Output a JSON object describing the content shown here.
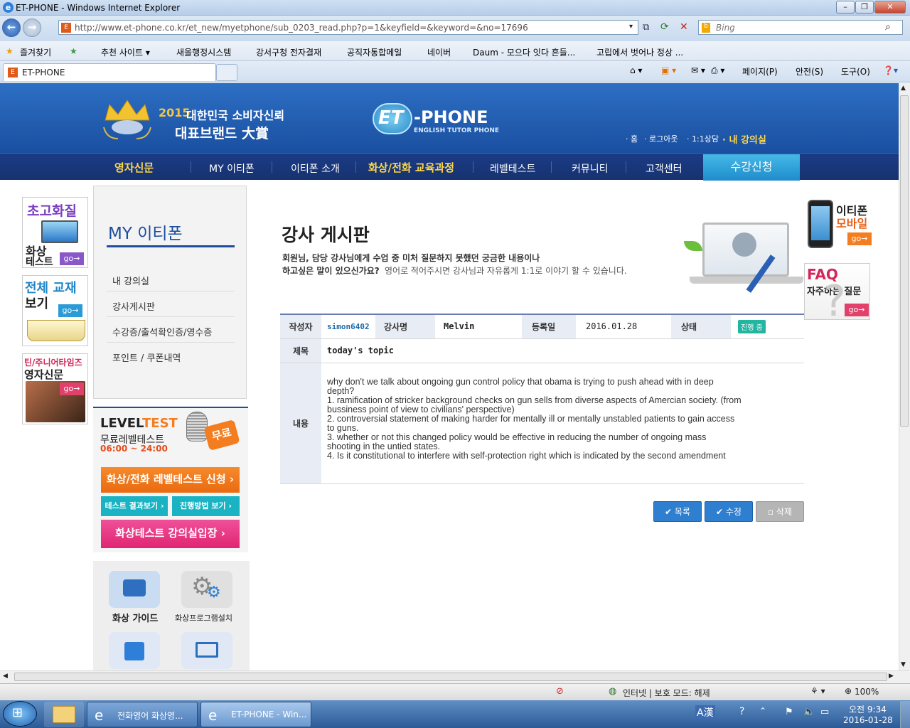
{
  "window": {
    "title": "ET-PHONE - Windows Internet Explorer"
  },
  "address": {
    "url": "http://www.et-phone.co.kr/et_new/myetphone/sub_0203_read.php?p=1&keyfield=&keyword=&no=17696",
    "search_placeholder": "Bing"
  },
  "favorites": {
    "label": "즐겨찾기",
    "items": [
      "추천 사이트 ▾",
      "새올행정시스템",
      "강서구청 전자결재",
      "공직자통합메일",
      "네이버",
      "Daum - 모으다 잇다 흔들...",
      "고립에서 벗어나 정상 ..."
    ]
  },
  "tab": {
    "label": "ET-PHONE"
  },
  "commands": [
    "페이지(P)",
    "안전(S)",
    "도구(O)"
  ],
  "site": {
    "award": {
      "year": "2015",
      "line1": "대한민국 소비자신뢰",
      "line2": "대표브랜드 大賞"
    },
    "logo": {
      "main": "ET",
      "suffix": "-PHONE",
      "sub": "ENGLISH TUTOR PHONE"
    },
    "toplinks": [
      "홈",
      "로그아웃",
      "1:1상담",
      "내 강의실"
    ],
    "menu": [
      "영자신문",
      "MY 이티폰",
      "이티폰 소개",
      "화상/전화 교육과정",
      "레벨테스트",
      "커뮤니티",
      "고객센터"
    ],
    "apply": "수강신청"
  },
  "sidebar": {
    "banners": [
      {
        "title": "초고화질",
        "sub1": "화상",
        "sub2": "테스트",
        "go": "go"
      },
      {
        "title": "전체 교재",
        "sub1": "보기",
        "go": "go"
      },
      {
        "title": "틴/주니어타임즈",
        "sub1": "영자신문",
        "go": "go"
      }
    ],
    "my_title": "MY 이티폰",
    "links": [
      "내 강의실",
      "강사게시판",
      "수강증/출석확인증/영수증",
      "포인트 / 쿠폰내역"
    ],
    "level": {
      "title_a": "LEVEL ",
      "title_b": "TEST",
      "sub": "무료레벨테스트",
      "time": "06:00 ~ 24:00",
      "badge": "무료"
    },
    "btn_apply": "화상/전화 레벨테스트 신청",
    "btn_result": "테스트 결과보기",
    "btn_howto": "진행방법 보기",
    "btn_enter": "화상테스트 강의실입장",
    "icons": [
      "화상 가이드",
      "화상프로그램설치"
    ]
  },
  "board": {
    "title": "강사 게시판",
    "desc1": "회원님, 담당 강사님에게 수업 중 미처 질문하지 못했던 궁금한 내용이나",
    "desc2a": "하고싶은 말이 있으신가요?",
    "desc2b": " 영어로 적어주시면 강사님과 자유롭게 1:1로 이야기 할 수 있습니다.",
    "labels": {
      "writer": "작성자",
      "teacher": "강사명",
      "date": "등록일",
      "status": "상태",
      "subject": "제목",
      "content": "내용"
    },
    "writer": "simon6402",
    "teacher": "Melvin",
    "date": "2016.01.28",
    "status": "진행 중",
    "subject": "today's topic",
    "content": [
      "why don't we talk about ongoing gun control policy that obama is trying to push ahead with in deep",
      "depth?",
      "1. ramification of stricker background checks on gun sells from diverse aspects of Amercian society. (from",
      "bussiness point of view to civilians' perspective)",
      "2. controversial statement of making harder for mentally ill or mentally unstabled patients to gain access",
      "to guns.",
      "3. whether or not this changed policy would be effective in reducing the number of ongoing mass",
      "shooting in the untied states.",
      "4. Is it constitutional to interfere with self-protection right which is indicated by the second amendment"
    ],
    "buttons": [
      "목록",
      "수정",
      "삭제"
    ]
  },
  "right_banners": {
    "mobile": {
      "l1": "이티폰",
      "l2": "모바일",
      "go": "go"
    },
    "faq": {
      "l1": "FAQ",
      "l2": "자주하는 질문",
      "go": "go"
    }
  },
  "status": {
    "zone": "인터넷 | 보호 모드: 해제",
    "zoom": "100%"
  },
  "taskbar": {
    "items": [
      "전화영어 화상영...",
      "ET-PHONE - Win..."
    ],
    "time": "오전 9:34",
    "date": "2016-01-28"
  },
  "colors": {
    "brand_blue": "#1a4fa0",
    "menu_navy": "#16326f",
    "accent_cyan": "#1e8ccb",
    "accent_yellow": "#ffd84a",
    "orange": "#f47d1f",
    "pink": "#e8347a"
  }
}
